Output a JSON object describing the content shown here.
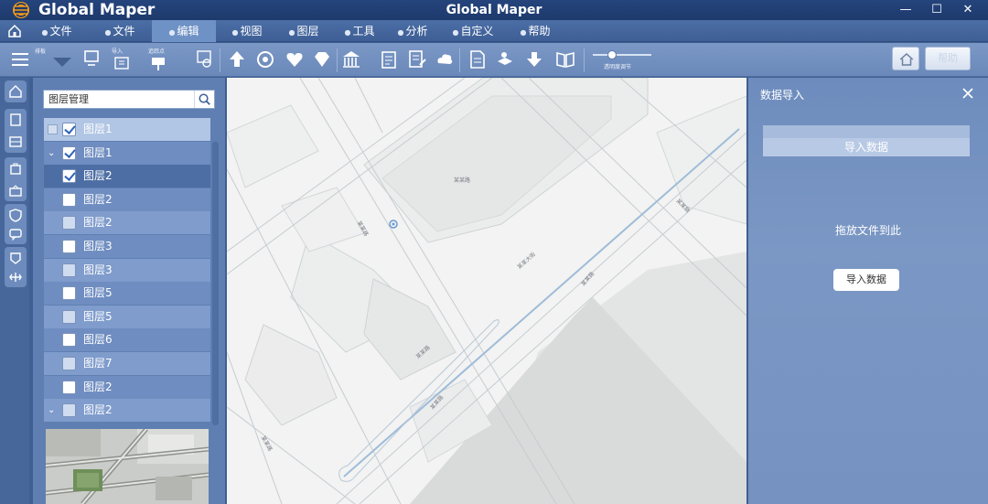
{
  "app": {
    "logo_text": "Global Maper",
    "window_title": "Global Maper"
  },
  "window_controls": {
    "minimize": "—",
    "maximize": "☐",
    "close": "✕"
  },
  "menu": [
    {
      "label": "文件",
      "active": false
    },
    {
      "label": "文件",
      "active": false
    },
    {
      "label": "编辑",
      "active": true
    },
    {
      "label": "视图",
      "active": false
    },
    {
      "label": "图层",
      "active": false
    },
    {
      "label": "工具",
      "active": false
    },
    {
      "label": "分析",
      "active": false
    },
    {
      "label": "自定义",
      "active": false
    },
    {
      "label": "帮助",
      "active": false
    }
  ],
  "toolbar": {
    "tiny_labels": [
      "排板",
      "导入",
      "追踪点"
    ],
    "slider_label": "透明度调节",
    "help_button": "帮助"
  },
  "layer_panel": {
    "search_placeholder": "图层管理",
    "layers": [
      {
        "label": "图层1",
        "checked": true,
        "state": "sel",
        "prefix": "box"
      },
      {
        "label": "图层1",
        "checked": true,
        "state": "alt",
        "prefix": "chevron"
      },
      {
        "label": "图层2",
        "checked": true,
        "state": "hl",
        "prefix": "none"
      },
      {
        "label": "图层2",
        "checked": false,
        "state": "alt",
        "prefix": "none"
      },
      {
        "label": "图层2",
        "checked": false,
        "state": "normal",
        "prefix": "none"
      },
      {
        "label": "图层3",
        "checked": false,
        "state": "alt",
        "prefix": "none"
      },
      {
        "label": "图层3",
        "checked": false,
        "state": "normal",
        "prefix": "none"
      },
      {
        "label": "图层5",
        "checked": false,
        "state": "alt",
        "prefix": "none"
      },
      {
        "label": "图层5",
        "checked": false,
        "state": "normal",
        "prefix": "none"
      },
      {
        "label": "图层6",
        "checked": false,
        "state": "alt",
        "prefix": "none"
      },
      {
        "label": "图层7",
        "checked": false,
        "state": "normal",
        "prefix": "none"
      },
      {
        "label": "图层2",
        "checked": false,
        "state": "alt",
        "prefix": "none"
      },
      {
        "label": "图层2",
        "checked": false,
        "state": "normal",
        "prefix": "chevron"
      }
    ]
  },
  "import_panel": {
    "title": "数据导入",
    "tab_label": "导入数据",
    "drop_hint": "拖放文件到此",
    "button_label": "导入数据"
  },
  "map": {
    "labels": [
      "某某路",
      "某某大街",
      "某某路",
      "某某路",
      "某某路",
      "某某路",
      "某某路",
      "某某路"
    ]
  },
  "colors": {
    "title_bar": "#1e3a6c",
    "menu_active": "#6f92c6",
    "panel_bg": "#5f7fb2",
    "map_bg": "#f3f4f3",
    "checkbox_check": "#2f63b8"
  }
}
